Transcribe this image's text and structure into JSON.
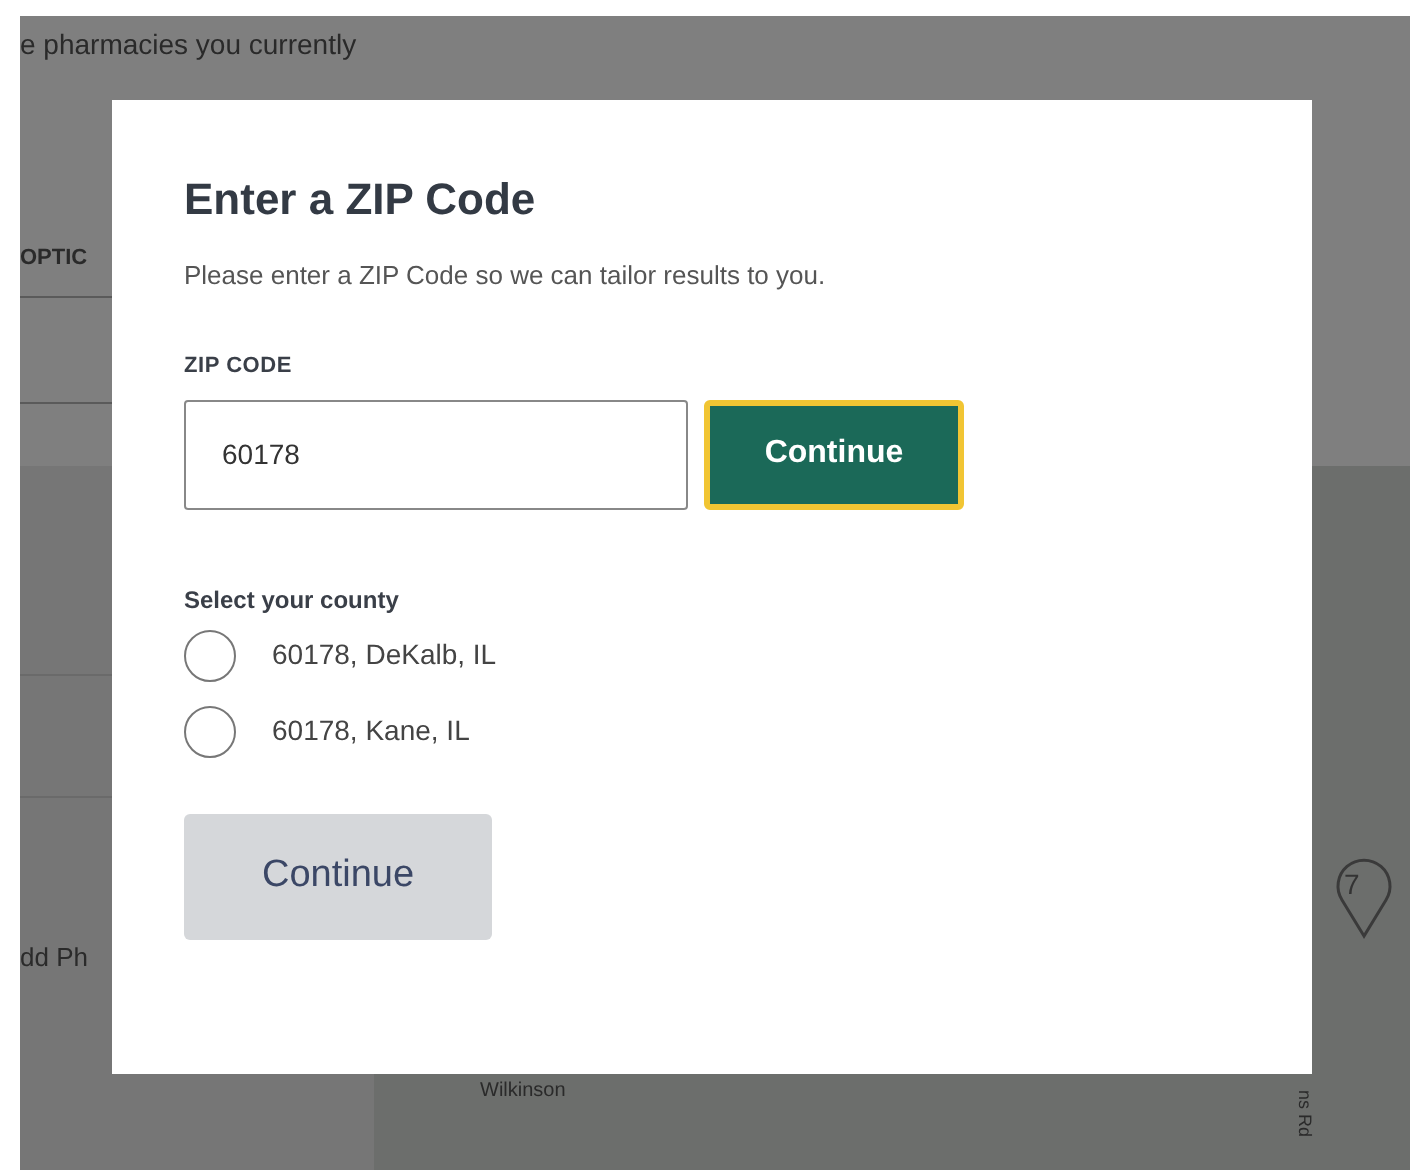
{
  "background": {
    "intro_text": "e pharmacies you currently",
    "tab": "OPTIC",
    "row_text": "dd Ph",
    "map": {
      "street_label": "Wilkinson",
      "road_label": "ns Rd",
      "marker": "7"
    }
  },
  "dialog": {
    "title": "Enter a ZIP Code",
    "description": "Please enter a ZIP Code so we can tailor results to you.",
    "zip_label": "ZIP CODE",
    "zip_value": "60178",
    "zip_button": "Continue",
    "county_label": "Select your county",
    "counties": [
      {
        "label": "60178, DeKalb, IL",
        "selected": false
      },
      {
        "label": "60178, Kane, IL",
        "selected": false
      }
    ],
    "continue_button": {
      "label": "Continue",
      "disabled": true
    }
  }
}
